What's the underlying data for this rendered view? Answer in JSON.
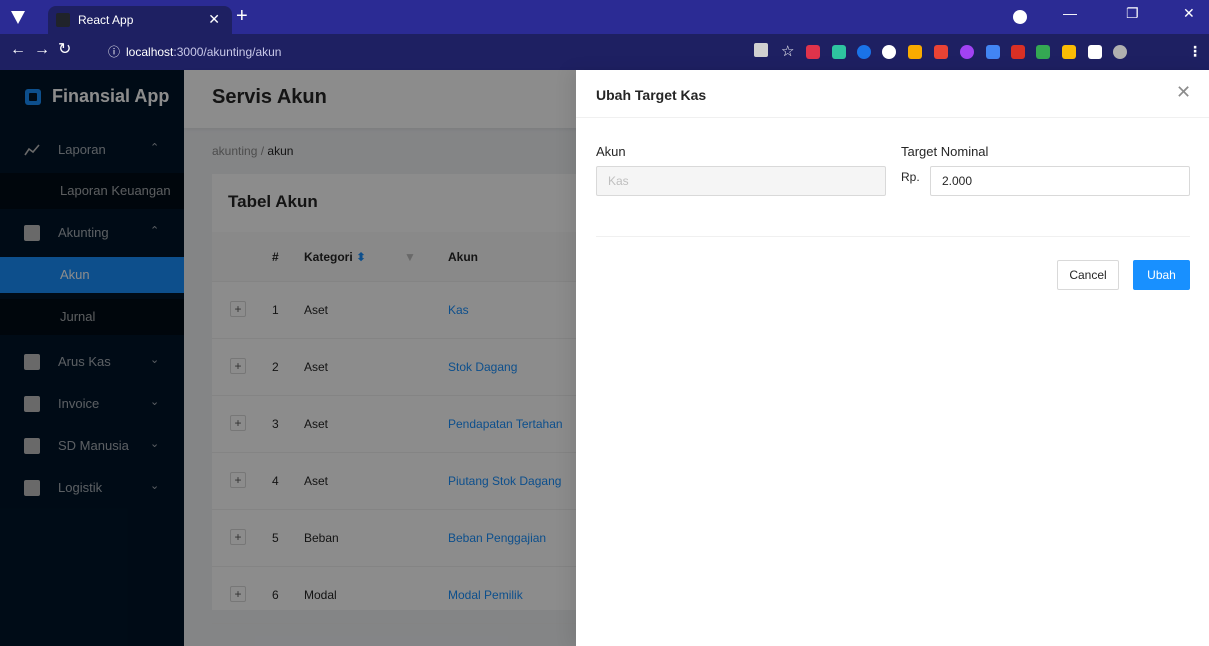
{
  "browser": {
    "tab_title": "React App",
    "url_host": "localhost",
    "url_path": ":3000/akunting/akun"
  },
  "sidebar": {
    "brand": "Finansial App",
    "items": [
      {
        "label": "Laporan",
        "icon": "line-chart-icon"
      },
      {
        "label": "Laporan Keuangan"
      },
      {
        "label": "Akunting",
        "icon": "bank-icon"
      },
      {
        "label": "Akun"
      },
      {
        "label": "Jurnal"
      },
      {
        "label": "Arus Kas",
        "icon": "cash-icon"
      },
      {
        "label": "Invoice",
        "icon": "file-icon"
      },
      {
        "label": "SD Manusia",
        "icon": "contacts-icon"
      },
      {
        "label": "Logistik",
        "icon": "box-icon"
      }
    ]
  },
  "page": {
    "title": "Servis Akun",
    "breadcrumb": [
      "akunting",
      "akun"
    ],
    "card_title": "Tabel Akun"
  },
  "table": {
    "columns": [
      "#",
      "Kategori",
      "Akun"
    ],
    "rows": [
      {
        "no": "1",
        "kategori": "Aset",
        "akun": "Kas"
      },
      {
        "no": "2",
        "kategori": "Aset",
        "akun": "Stok Dagang"
      },
      {
        "no": "3",
        "kategori": "Aset",
        "akun": "Pendapatan Tertahan"
      },
      {
        "no": "4",
        "kategori": "Aset",
        "akun": "Piutang Stok Dagang"
      },
      {
        "no": "5",
        "kategori": "Beban",
        "akun": "Beban Penggajian"
      },
      {
        "no": "6",
        "kategori": "Modal",
        "akun": "Modal Pemilik"
      }
    ]
  },
  "drawer": {
    "title": "Ubah Target Kas",
    "akun_label": "Akun",
    "akun_value": "Kas",
    "target_label": "Target Nominal",
    "prefix": "Rp.",
    "target_value": "2.000",
    "cancel_label": "Cancel",
    "submit_label": "Ubah"
  },
  "colors": {
    "primary": "#1890ff",
    "sidebar": "#001529",
    "browser_frame": "#2b2b94"
  }
}
